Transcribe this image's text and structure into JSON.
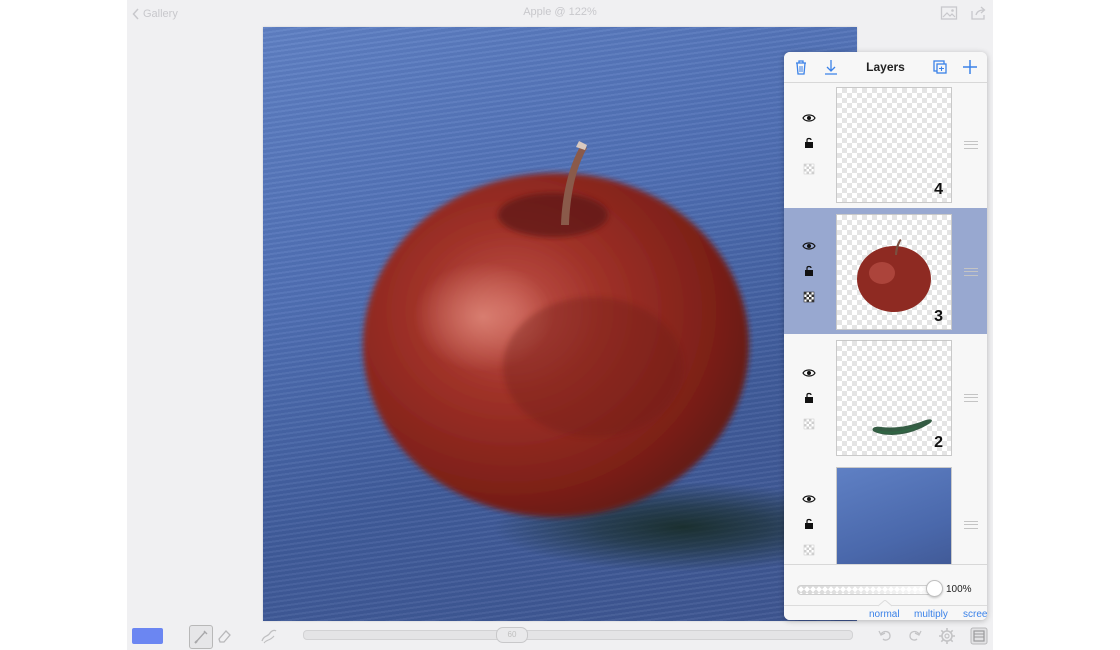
{
  "top_bar": {
    "back_label": "Gallery",
    "title": "Apple @ 122%"
  },
  "layers_panel": {
    "title": "Layers",
    "layers": [
      {
        "number": "4",
        "visible": true,
        "locked": true,
        "content": "empty"
      },
      {
        "number": "3",
        "visible": true,
        "locked": true,
        "content": "apple",
        "selected": true
      },
      {
        "number": "2",
        "visible": true,
        "locked": true,
        "content": "green stroke"
      },
      {
        "number": "",
        "visible": true,
        "locked": true,
        "content": "blue background"
      }
    ],
    "opacity": {
      "value": 1.0,
      "label": "100%"
    },
    "blend_modes": [
      "normal",
      "multiply",
      "screen"
    ],
    "selected_blend_mode": "normal"
  },
  "toolbar": {
    "current_color": "#6b86f2",
    "brush_size_label": "60",
    "brush_size": 0.35
  },
  "colors": {
    "accent": "#3b82e8",
    "selected_layer": "#98a8d0",
    "canvas_blue": "#4f6fb4",
    "apple_red": "#8e2a22"
  }
}
